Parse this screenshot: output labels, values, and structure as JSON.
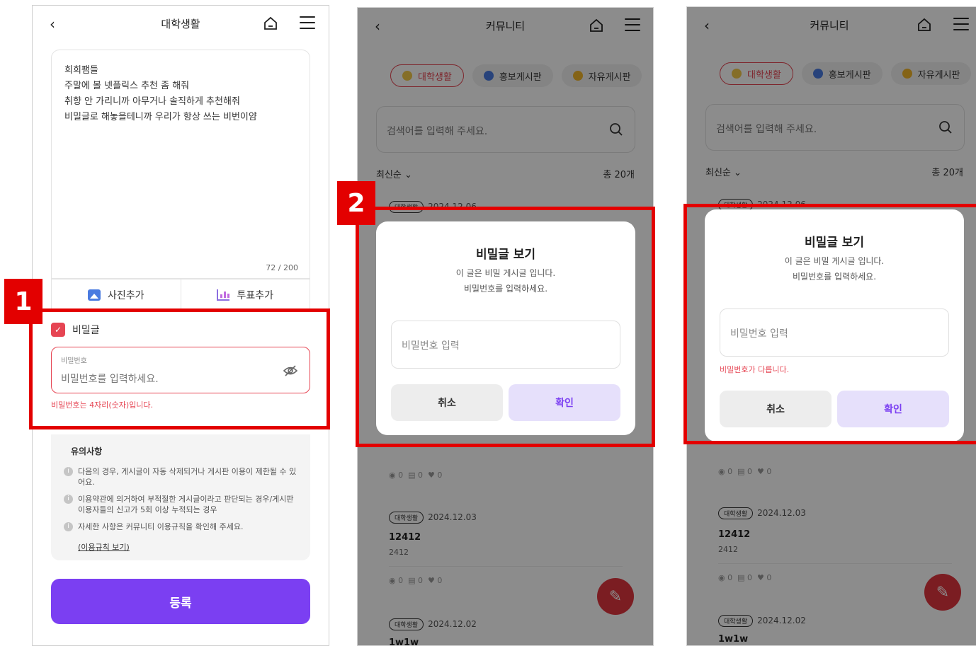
{
  "screen1": {
    "title": "대학생활",
    "content_lines": [
      "희희팸들",
      "주말에 볼 넷플릭스 추천 좀 해줘",
      "취향 안 가리니까 아무거나 솔직하게 추천해줘",
      "비밀글로 해놓을테니까 우리가 항상 쓰는 비번이얌"
    ],
    "counter": "72 / 200",
    "add_photo": "사진추가",
    "add_vote": "투표추가",
    "secret_label": "비밀글",
    "pw_label": "비밀번호",
    "pw_placeholder": "비밀번호를 입력하세요.",
    "pw_error": "비밀번호는 4자리(숫자)입니다.",
    "notice_title": "유의사항",
    "notice_items": [
      "다음의 경우, 게시글이 자동 삭제되거나 게시판 이용이 제한될 수 있어요.",
      "이용약관에 의거하여 부적절한 게시글이라고 판단되는 경우/게시판 이용자들의 신고가 5회 이상 누적되는 경우",
      "자세한 사항은 커뮤니티 이용규칙을 확인해 주세요."
    ],
    "notice_link": "(이용규칙 보기)",
    "submit": "등록"
  },
  "community": {
    "title": "커뮤니티",
    "tabs": [
      "대학생활",
      "홍보게시판",
      "자유게시판"
    ],
    "search_placeholder": "검색어를 입력해 주세요.",
    "sort": "최신순",
    "total": "총 20개",
    "badge": "대학생활",
    "cards": [
      {
        "date": "2024.12.06"
      },
      {
        "date": "2024.12.03",
        "title": "12412",
        "snippet": "2412",
        "views": "0",
        "comments": "0",
        "likes": "0"
      },
      {
        "date": "2024.12.02",
        "title": "1w1w"
      }
    ],
    "prev_card_stats": {
      "views": "0",
      "comments": "0",
      "likes": "0"
    }
  },
  "modal": {
    "title": "비밀글 보기",
    "desc1": "이 글은 비밀 게시글 입니다.",
    "desc2": "비밀번호를 입력하세요.",
    "input_placeholder": "비밀번호 입력",
    "error": "비밀번호가 다릅니다.",
    "cancel": "취소",
    "confirm": "확인"
  },
  "annotations": {
    "step1": "1",
    "step2": "2"
  },
  "colors": {
    "accent_red": "#e64553",
    "primary_purple": "#7b3ff2",
    "highlight_red": "#e30000"
  }
}
